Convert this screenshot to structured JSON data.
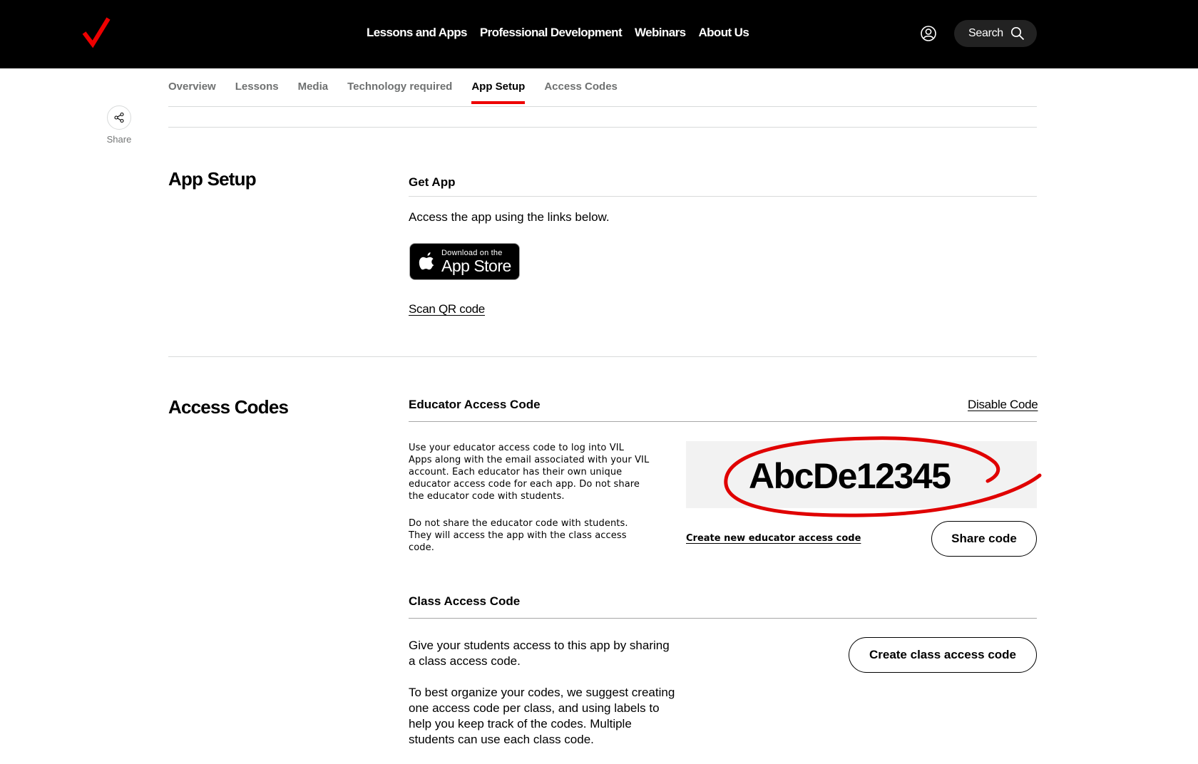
{
  "header": {
    "nav": [
      "Lessons and Apps",
      "Professional Development",
      "Webinars",
      "About Us"
    ],
    "search_label": "Search"
  },
  "subnav": {
    "items": [
      "Overview",
      "Lessons",
      "Media",
      "Technology required",
      "App Setup",
      "Access Codes"
    ],
    "active": "App Setup"
  },
  "share": {
    "label": "Share"
  },
  "app_setup": {
    "title": "App Setup",
    "get_app": {
      "heading": "Get App",
      "description": "Access the app using the links below.",
      "store_badge_small": "Download on the",
      "store_badge_big": "App Store",
      "qr_link": "Scan QR code"
    }
  },
  "access_codes": {
    "title": "Access Codes",
    "educator": {
      "heading": "Educator Access Code",
      "disable_link": "Disable Code",
      "description_lines": [
        "Use your educator access code to log into VIL",
        "Apps along with the email associated with your VIL",
        "account. Each educator has their own unique",
        "educator access code for each app. Do not share",
        "the educator code with students."
      ],
      "warning_lines": [
        "Do not share the educator code with students.",
        "They will access the app with the class access",
        "code."
      ],
      "code": "AbcDe12345",
      "create_new_link": "Create new educator access code",
      "share_button": "Share code"
    },
    "class": {
      "heading": "Class Access Code",
      "description_lines": [
        "Give your students access to this app by sharing",
        "a class access code."
      ],
      "tip_lines": [
        "To best organize your codes, we suggest creating",
        "one access code per class, and using labels to",
        "help you keep track of the codes. Multiple",
        "students can use each class code."
      ],
      "create_button": "Create class access code"
    }
  },
  "colors": {
    "brand_red": "#ee0000",
    "annotation_red": "#e00000",
    "header_bg": "#000000"
  }
}
